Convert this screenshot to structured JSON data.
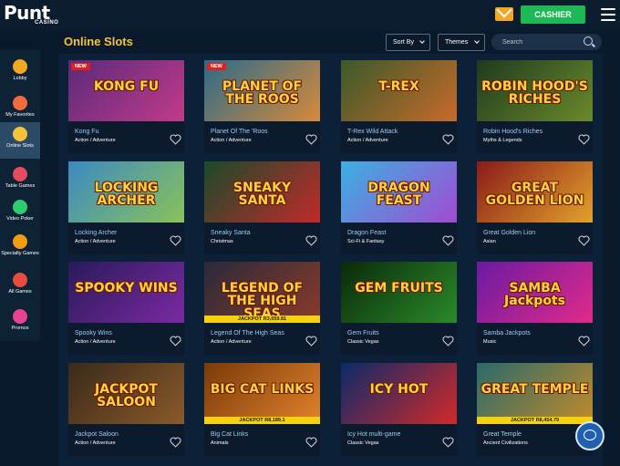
{
  "header": {
    "logo_word": "Punt",
    "logo_sub": "CASINO",
    "cashier_label": "CASHIER",
    "mail_icon": "envelope-icon",
    "menu_icon": "hamburger-icon"
  },
  "sidebar": {
    "items": [
      {
        "label": "Lobby",
        "icon": "lobby-icon",
        "color": "#f5a623"
      },
      {
        "label": "My Favorites",
        "icon": "heart-icon",
        "color": "#f26b3a"
      },
      {
        "label": "Online Slots",
        "icon": "slot-machine-icon",
        "color": "#f5c23a",
        "active": true
      },
      {
        "label": "Table Games",
        "icon": "roulette-icon",
        "color": "#e84a5f"
      },
      {
        "label": "Video Poker",
        "icon": "cards-icon",
        "color": "#2ecc71"
      },
      {
        "label": "Specialty Games",
        "icon": "specialty-icon",
        "color": "#f39c12"
      },
      {
        "label": "All Games",
        "icon": "all-games-icon",
        "color": "#e74c3c"
      },
      {
        "label": "Promos",
        "icon": "gift-icon",
        "color": "#e84393"
      }
    ]
  },
  "main": {
    "title": "Online Slots",
    "sort_label": "Sort By",
    "themes_label": "Themes",
    "search_placeholder": "Search"
  },
  "games": [
    {
      "name": "Kong Fu",
      "category": "Action / Adventure",
      "art": "KONG FU",
      "badge": "NEW",
      "jackpot": "",
      "c1": "#5b2a7a",
      "c2": "#c23a8a"
    },
    {
      "name": "Planet Of The 'Roos",
      "category": "Action / Adventure",
      "art": "PLANET OF THE ROOS",
      "badge": "NEW",
      "jackpot": "",
      "c1": "#2a6b8a",
      "c2": "#d88a3a"
    },
    {
      "name": "T-Rex Wild Attack",
      "category": "Action / Adventure",
      "art": "T-REX",
      "badge": "",
      "jackpot": "",
      "c1": "#3a5a2a",
      "c2": "#c86a2a"
    },
    {
      "name": "Robin Hood's Riches",
      "category": "Myths & Legends",
      "art": "ROBIN HOOD'S RICHES",
      "badge": "",
      "jackpot": "",
      "c1": "#1f3a1f",
      "c2": "#6a8a2a"
    },
    {
      "name": "Locking Archer",
      "category": "Action / Adventure",
      "art": "LOCKING ARCHER",
      "badge": "",
      "jackpot": "",
      "c1": "#3a8ac2",
      "c2": "#8ac25a"
    },
    {
      "name": "Sneaky Santa",
      "category": "Christmas",
      "art": "SNEAKY SANTA",
      "badge": "",
      "jackpot": "",
      "c1": "#1a4a2a",
      "c2": "#c22a2a"
    },
    {
      "name": "Dragon Feast",
      "category": "Sci-Fi & Fantasy",
      "art": "DRAGON FEAST",
      "badge": "",
      "jackpot": "",
      "c1": "#3ab2e2",
      "c2": "#a24ad2"
    },
    {
      "name": "Great Golden Lion",
      "category": "Asian",
      "art": "GREAT GOLDEN LION",
      "badge": "",
      "jackpot": "",
      "c1": "#8a1a1a",
      "c2": "#e2a22a"
    },
    {
      "name": "Spooky Wins",
      "category": "Action / Adventure",
      "art": "SPOOKY WINS",
      "badge": "",
      "jackpot": "",
      "c1": "#2a1a5a",
      "c2": "#7a2aa2"
    },
    {
      "name": "Legend Of The High Seas",
      "category": "Action / Adventure",
      "art": "LEGEND OF THE HIGH SEAS",
      "badge": "",
      "jackpot": "JACKPOT R3,059.81",
      "c1": "#2a2a3a",
      "c2": "#8a3a2a"
    },
    {
      "name": "Gem Fruits",
      "category": "Classic Vegas",
      "art": "GEM FRUITS",
      "badge": "",
      "jackpot": "",
      "c1": "#0a2a0a",
      "c2": "#2a8a2a"
    },
    {
      "name": "Samba Jackpots",
      "category": "Music",
      "art": "SAMBA Jackpots",
      "badge": "",
      "jackpot": "",
      "c1": "#6a1aa2",
      "c2": "#e22a8a"
    },
    {
      "name": "Jackpot Saloon",
      "category": "Action / Adventure",
      "art": "JACKPOT SALOON",
      "badge": "",
      "jackpot": "",
      "c1": "#3a2a1a",
      "c2": "#8a5a2a"
    },
    {
      "name": "Big Cat Links",
      "category": "Animals",
      "art": "BIG CAT LINKS",
      "badge": "",
      "jackpot": "JACKPOT R8,189.1",
      "c1": "#7a3a0a",
      "c2": "#e2822a"
    },
    {
      "name": "Icy Hot multi-game",
      "category": "Classic Vegas",
      "art": "ICY HOT",
      "badge": "",
      "jackpot": "",
      "c1": "#0a2a6a",
      "c2": "#d22a2a"
    },
    {
      "name": "Great Temple",
      "category": "Ancient Civilizations",
      "art": "GREAT TEMPLE",
      "badge": "",
      "jackpot": "JACKPOT R8,454.79",
      "c1": "#2a6a6a",
      "c2": "#c28a2a"
    }
  ],
  "chat_icon": "chat-bubble-icon"
}
